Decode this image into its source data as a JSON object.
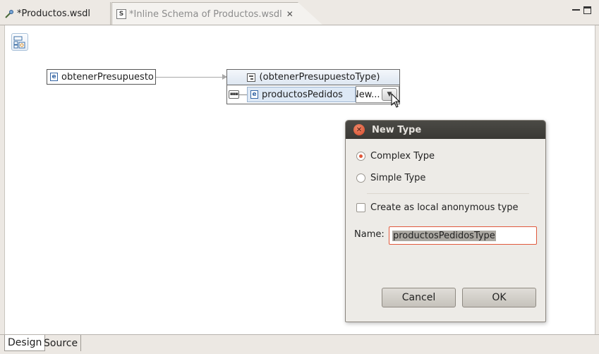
{
  "editor_tabs": [
    {
      "label": "*Productos.wsdl",
      "icon": "wsdl-icon",
      "active": false
    },
    {
      "label": "*Inline Schema of Productos.wsdl",
      "icon": "schema-icon",
      "active": true
    }
  ],
  "diagram": {
    "root_element": "obtenerPresupuesto",
    "type_header": "(obtenerPresupuestoType)",
    "child_element": "productosPedidos",
    "type_combo_value": "New..."
  },
  "dialog": {
    "title": "New Type",
    "options": [
      "Complex Type",
      "Simple Type"
    ],
    "selected_option": "Complex Type",
    "anonymous_label": "Create as local anonymous type",
    "anonymous_checked": false,
    "name_label": "Name:",
    "name_value": "productosPedidosType",
    "cancel_label": "Cancel",
    "ok_label": "OK"
  },
  "bottom_tabs": [
    {
      "label": "Design",
      "active": true
    },
    {
      "label": "Source",
      "active": false
    }
  ],
  "colors": {
    "accent": "#e0583a",
    "title_bar": "#3d3c38",
    "selection": "#dde8f5"
  }
}
